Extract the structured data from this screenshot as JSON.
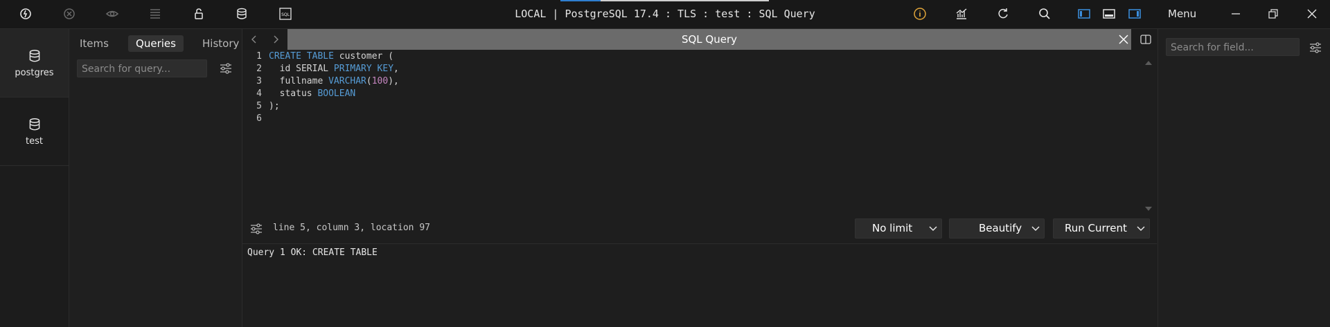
{
  "titlebar": {
    "title": "LOCAL | PostgreSQL 17.4 : TLS : test : SQL Query",
    "menu_label": "Menu",
    "left_icons": [
      "connection-icon",
      "disconnect-icon",
      "eye-icon",
      "list-icon",
      "lock-icon",
      "database-icon",
      "sql-icon"
    ],
    "right_icons": [
      "info-icon",
      "chart-icon",
      "refresh-icon",
      "search-icon",
      "left-panel-icon",
      "bottom-panel-icon",
      "right-panel-icon"
    ],
    "window_controls": [
      "minimize-icon",
      "restore-icon",
      "close-icon"
    ],
    "accent_color": "#2f7fd1",
    "info_color": "#e0a53a"
  },
  "databases": [
    {
      "label": "postgres"
    },
    {
      "label": "test"
    }
  ],
  "queries_panel": {
    "tabs": [
      "Items",
      "Queries",
      "History"
    ],
    "active_tab": "Queries",
    "search_placeholder": "Search for query..."
  },
  "editor": {
    "tab_title": "SQL Query",
    "line_numbers": [
      "1",
      "2",
      "3",
      "4",
      "5",
      "6"
    ],
    "status": "line 5, column 3, location 97",
    "limit_label": "No limit",
    "beautify_label": "Beautify",
    "run_label": "Run Current",
    "output": "Query 1 OK: CREATE TABLE"
  },
  "code_lines": [
    [
      {
        "t": "CREATE TABLE",
        "k": "kw"
      },
      {
        "t": " customer (",
        "k": ""
      }
    ],
    [
      {
        "t": "  id SERIAL ",
        "k": ""
      },
      {
        "t": "PRIMARY KEY",
        "k": "kw"
      },
      {
        "t": ",",
        "k": ""
      }
    ],
    [
      {
        "t": "  fullname ",
        "k": ""
      },
      {
        "t": "VARCHAR",
        "k": "kw"
      },
      {
        "t": "(",
        "k": ""
      },
      {
        "t": "100",
        "k": "num"
      },
      {
        "t": "),",
        "k": ""
      }
    ],
    [
      {
        "t": "  status ",
        "k": ""
      },
      {
        "t": "BOOLEAN",
        "k": "kw"
      }
    ],
    [
      {
        "t": ");",
        "k": ""
      }
    ],
    []
  ],
  "right_panel": {
    "search_placeholder": "Search for field..."
  }
}
